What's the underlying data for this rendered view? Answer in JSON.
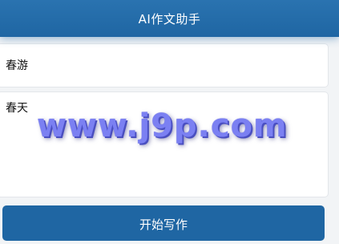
{
  "header": {
    "title": "AI作文助手"
  },
  "form": {
    "topic_value": "春游",
    "content_value": "春天"
  },
  "watermark": {
    "text": "www.j9p.com"
  },
  "actions": {
    "start_label": "开始写作"
  },
  "colors": {
    "header": "#1f66a3",
    "button": "#1f66a3",
    "background": "#f2f4f6",
    "watermark": "#7b80f2"
  }
}
